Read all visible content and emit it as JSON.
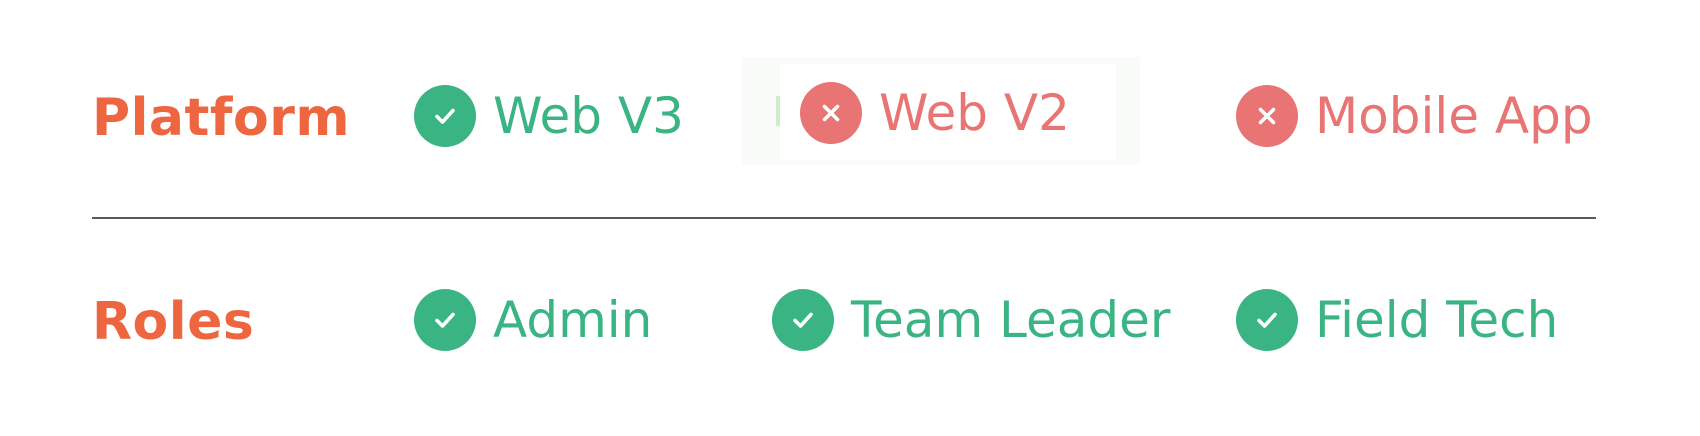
{
  "colors": {
    "label": "#EE6640",
    "enabled": "#3AB483",
    "disabled": "#E87474"
  },
  "platform": {
    "label": "Platform",
    "items": [
      {
        "text": "Web V3",
        "status": "enabled",
        "icon": "check-icon"
      },
      {
        "text": "Web V2",
        "status": "disabled",
        "icon": "x-icon"
      },
      {
        "text": "Mobile App",
        "status": "disabled",
        "icon": "x-icon"
      }
    ]
  },
  "roles": {
    "label": "Roles",
    "items": [
      {
        "text": "Admin",
        "status": "enabled",
        "icon": "check-icon"
      },
      {
        "text": "Team Leader",
        "status": "enabled",
        "icon": "check-icon"
      },
      {
        "text": "Field Tech",
        "status": "enabled",
        "icon": "check-icon"
      }
    ]
  }
}
